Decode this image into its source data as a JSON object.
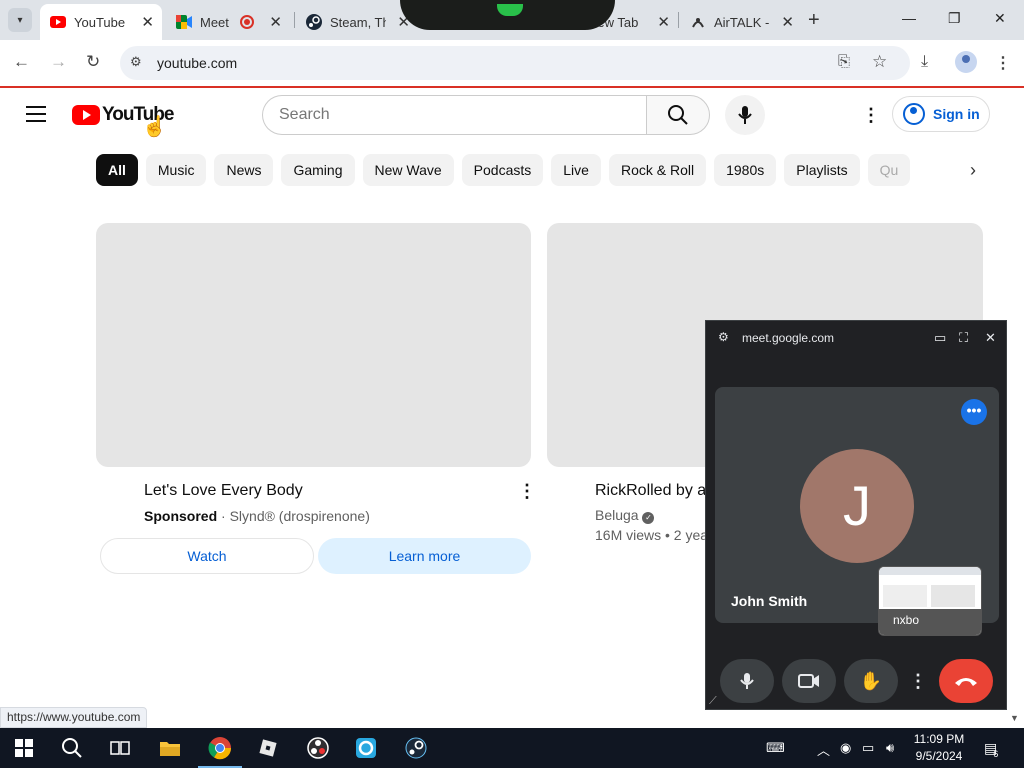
{
  "browser": {
    "tabs": [
      {
        "title": "YouTube",
        "active": true,
        "favicon": "youtube-favicon"
      },
      {
        "title": "Meet -",
        "active": false,
        "favicon": "meet-favicon",
        "recording": true
      },
      {
        "title": "Steam, Th",
        "active": false,
        "favicon": "steam-favicon"
      },
      {
        "title": "",
        "active": false,
        "favicon": "chrome-favicon"
      },
      {
        "title": "New Tab",
        "active": false,
        "favicon": "chrome-favicon"
      },
      {
        "title": "AirTALK - ",
        "active": false,
        "favicon": "airtalk-favicon"
      }
    ],
    "address": "youtube.com",
    "status_url": "https://www.youtube.com"
  },
  "youtube": {
    "logo_text": "YouTube",
    "search_placeholder": "Search",
    "sign_in": "Sign in",
    "chips": [
      "All",
      "Music",
      "News",
      "Gaming",
      "New Wave",
      "Podcasts",
      "Live",
      "Rock & Roll",
      "1980s",
      "Playlists",
      "Qu"
    ],
    "cards": [
      {
        "title": "Let's Love Every Body",
        "sponsored": "Sponsored",
        "sponsor": "Slynd® (drospirenone)",
        "watch": "Watch",
        "learn_more": "Learn more"
      },
      {
        "title": "RickRolled by a",
        "channel": "Beluga",
        "meta": "16M views • 2 yea"
      }
    ]
  },
  "meet_pip": {
    "host": "meet.google.com",
    "participant_initial": "J",
    "participant_name": "John Smith",
    "self_view_label": "nxbo"
  },
  "taskbar": {
    "time": "11:09 PM",
    "date": "9/5/2024",
    "notifications": "6"
  },
  "colors": {
    "youtube_red": "#ff0000",
    "link_blue": "#065fd4",
    "meet_hangup": "#ea4335",
    "avatar": "#a1776a",
    "taskbar": "#101622"
  }
}
